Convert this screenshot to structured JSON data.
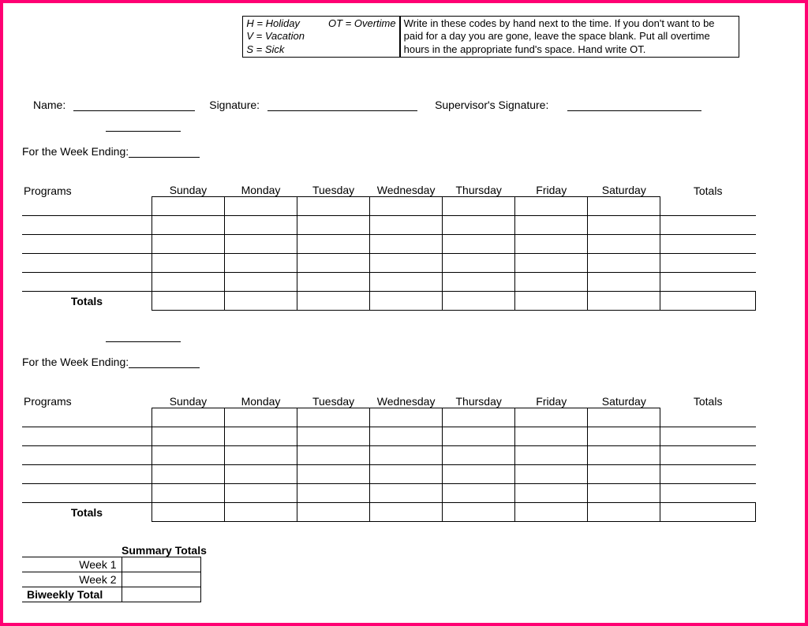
{
  "legend": {
    "holiday": "H = Holiday",
    "overtime": "OT = Overtime",
    "vacation": "V = Vacation",
    "sick": "S = Sick"
  },
  "instructions": "Write in these codes by hand next to the time.  If you don't want to be paid for a day you are gone, leave the space blank.  Put all overtime hours in the appropriate fund's space. Hand write OT.",
  "labels": {
    "name": "Name:",
    "signature": "Signature:",
    "supervisor": "Supervisor's Signature:",
    "week_ending": "For the Week Ending:",
    "programs": "Programs",
    "totals_col": "Totals",
    "totals_row": "Totals",
    "summary_title": "Summary Totals",
    "week1": "Week 1",
    "week2": "Week 2",
    "biweekly": "Biweekly Total"
  },
  "days": [
    "Sunday",
    "Monday",
    "Tuesday",
    "Wednesday",
    "Thursday",
    "Friday",
    "Saturday"
  ],
  "summary": {
    "week1": "",
    "week2": "",
    "biweekly": ""
  }
}
